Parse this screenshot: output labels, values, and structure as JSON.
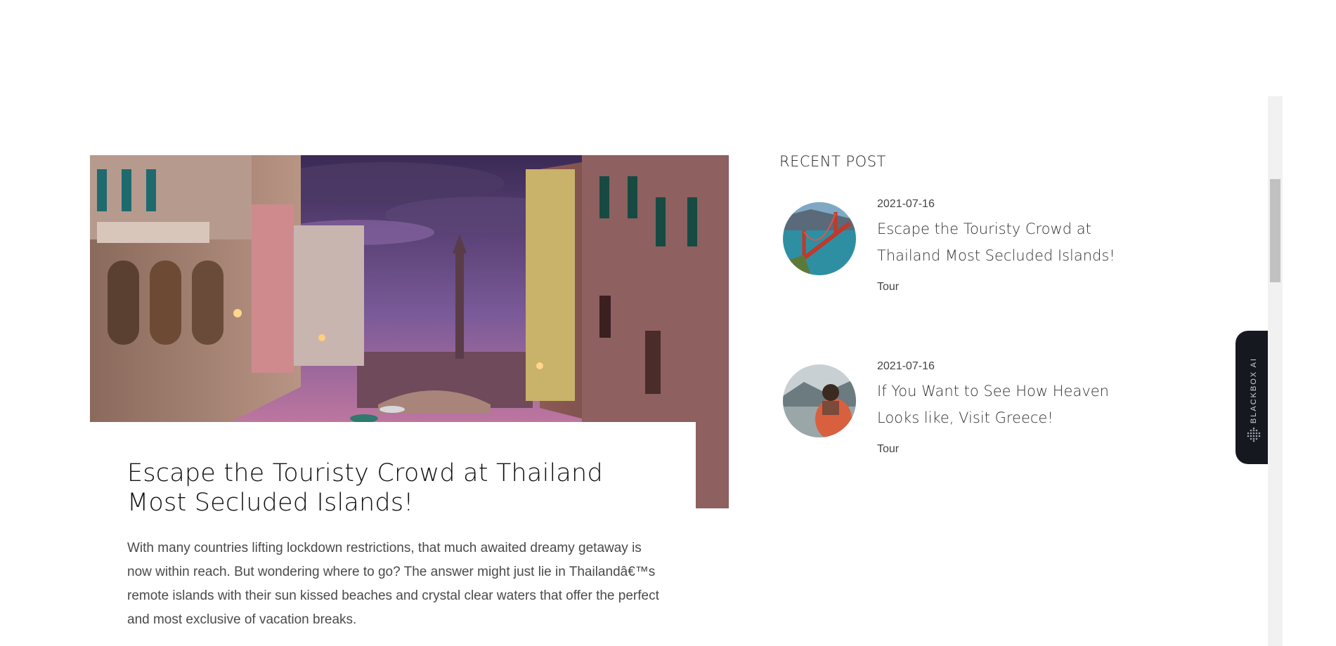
{
  "main_post": {
    "title": "Escape the Touristy Crowd at Thailand Most Secluded Islands!",
    "excerpt": "With many countries lifting lockdown restrictions, that much awaited dreamy getaway is now within reach. But wondering where to go? The answer might just lie in Thailandâ€™s remote islands with their sun kissed beaches and crystal clear waters that offer the perfect and most exclusive of vacation breaks.",
    "image_icon": "venice-canal-photo"
  },
  "sidebar": {
    "heading": "RECENT POST",
    "posts": [
      {
        "date": "2021-07-16",
        "title": "Escape the Touristy Crowd at Thailand Most Secluded Islands!",
        "category": "Tour",
        "thumb_icon": "golden-gate-bridge-photo"
      },
      {
        "date": "2021-07-16",
        "title": "If You Want to See How Heaven Looks like, Visit Greece!",
        "category": "Tour",
        "thumb_icon": "traveler-mountain-lake-photo"
      }
    ]
  },
  "widget": {
    "label": "BLACKBOX AI",
    "icon": "blackbox-dots-icon",
    "color": "#15181f"
  },
  "scrollbar": {
    "track_color": "#f1f1f1",
    "thumb_color": "#c1c1c1"
  }
}
